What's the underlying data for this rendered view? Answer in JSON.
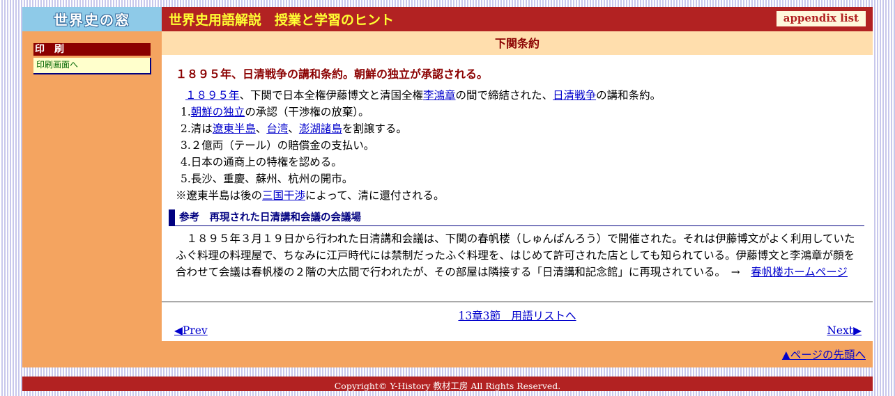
{
  "header": {
    "logo": "世界史の窓",
    "title": "世界史用語解説　授業と学習のヒント",
    "appendix": "appendix list"
  },
  "sidebar": {
    "print_heading": "印　刷",
    "print_link": "印刷画面へ"
  },
  "term": {
    "name": "下関条約",
    "lead": "１８９５年、日清戦争の講和条約。朝鮮の独立が承認される。",
    "intro": {
      "link1": "１８９５年",
      "t1": "、下関で日本全権伊藤博文と清国全権",
      "link2": "李鴻章",
      "t2": "の間で締結された、",
      "link3": "日清戦争",
      "t3": "の講和条約。"
    },
    "items": [
      {
        "num": "1.",
        "link": "朝鮮の独立",
        "after": "の承認（干渉権の放棄）。"
      },
      {
        "num": "2.",
        "before": "清は",
        "l1": "遼東半島",
        "s1": "、",
        "l2": "台湾",
        "s2": "、",
        "l3": "澎湖諸島",
        "after": "を割譲する。"
      },
      {
        "num": "3.",
        "text": "２億両（テール）の賠償金の支払い。"
      },
      {
        "num": "4.",
        "text": "日本の通商上の特権を認める。"
      },
      {
        "num": "5.",
        "text": "長沙、重慶、蘇州、杭州の開市。"
      }
    ],
    "note": {
      "before": "※遼東半島は後の",
      "link": "三国干渉",
      "after": "によって、清に還付される。"
    }
  },
  "reference": {
    "title": "参考　再現された日清講和会議の会議場",
    "text": "　１８９５年３月１９日から行われた日清講和会議は、下関の春帆楼（しゅんぱんろう）で開催された。それは伊藤博文がよく利用していたふぐ料理の料理屋で、ちなみに江戸時代には禁制だったふぐ料理を、はじめて許可された店としても知られている。伊藤博文と李鴻章が顔を合わせて会議は春帆楼の２階の大広間で行われたが、その部屋は隣接する「日清講和記念館」に再現されている。　→　",
    "link": "春帆楼ホームページ"
  },
  "nav": {
    "list": "13章3節　用語リストへ",
    "prev": "◀Prev",
    "next": "Next▶",
    "pagetop": "▲ページの先頭へ"
  },
  "footer": {
    "copyright": "Copyright© Y-History 教材工房 All Rights Reserved."
  }
}
